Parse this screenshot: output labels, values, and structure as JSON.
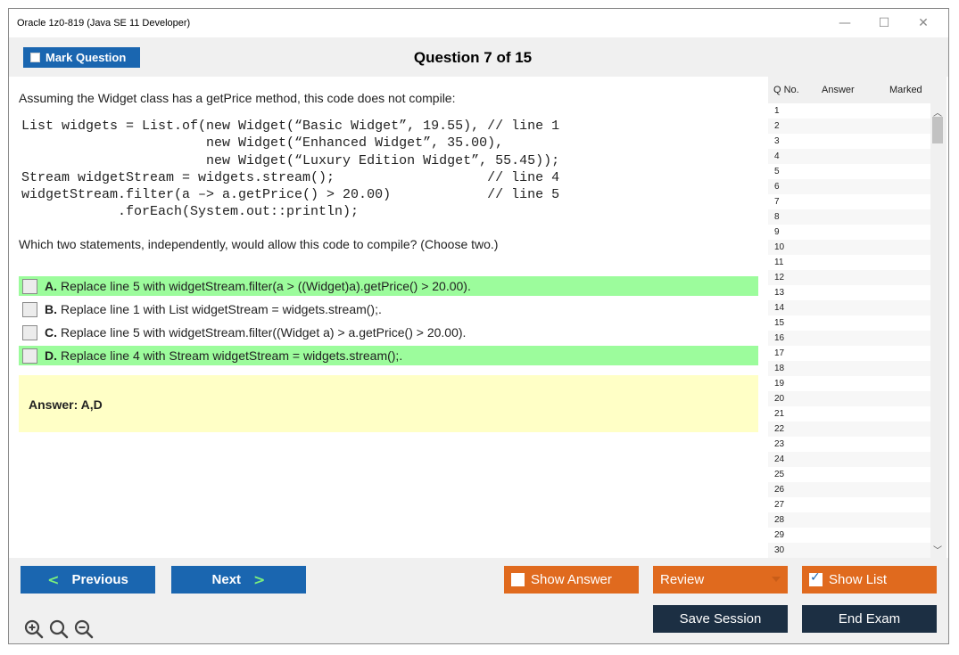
{
  "window": {
    "title": "Oracle 1z0-819 (Java SE 11 Developer)",
    "controls": {
      "minimize": "—",
      "maximize": "☐",
      "close": "✕"
    }
  },
  "header": {
    "mark_question_label": "Mark Question",
    "question_title": "Question 7 of 15"
  },
  "question": {
    "prompt": "Assuming the Widget class has a getPrice method, this code does not compile:",
    "code_lines": [
      "List widgets = List.of(new Widget(“Basic Widget”, 19.55), // line 1",
      "                       new Widget(“Enhanced Widget”, 35.00),",
      "                       new Widget(“Luxury Edition Widget”, 55.45));",
      "Stream widgetStream = widgets.stream();                   // line 4",
      "widgetStream.filter(a –> a.getPrice() > 20.00)            // line 5",
      "            .forEach(System.out::println);"
    ],
    "instruction": "Which two statements, independently, would allow this code to compile? (Choose two.)",
    "options": [
      {
        "letter": "A.",
        "text": "Replace line 5 with widgetStream.filter(a > ((Widget)a).getPrice() > 20.00).",
        "highlighted": true
      },
      {
        "letter": "B.",
        "text": "Replace line 1 with List widgetStream = widgets.stream();.",
        "highlighted": false
      },
      {
        "letter": "C.",
        "text": "Replace line 5 with widgetStream.filter((Widget a) > a.getPrice() > 20.00).",
        "highlighted": false
      },
      {
        "letter": "D.",
        "text": "Replace line 4 with Stream widgetStream = widgets.stream();.",
        "highlighted": true
      }
    ],
    "answer_text": "Answer: A,D"
  },
  "question_list": {
    "headers": {
      "qno": "Q No.",
      "answer": "Answer",
      "marked": "Marked"
    },
    "rows": [
      "1",
      "2",
      "3",
      "4",
      "5",
      "6",
      "7",
      "8",
      "9",
      "10",
      "11",
      "12",
      "13",
      "14",
      "15",
      "16",
      "17",
      "18",
      "19",
      "20",
      "21",
      "22",
      "23",
      "24",
      "25",
      "26",
      "27",
      "28",
      "29",
      "30"
    ]
  },
  "footer": {
    "previous_label": "Previous",
    "next_label": "Next",
    "show_answer_label": "Show Answer",
    "review_label": "Review",
    "show_list_label": "Show List",
    "save_session_label": "Save Session",
    "end_exam_label": "End Exam"
  },
  "colors": {
    "primary_blue": "#1a66b0",
    "orange": "#e06a1e",
    "dark_navy": "#1c2f43",
    "correct_highlight": "#9cfc9c",
    "answer_background": "#ffffc6"
  },
  "icons": {
    "zoom_in": "zoom-in-icon",
    "zoom_reset": "zoom-reset-icon",
    "zoom_out": "zoom-out-icon"
  }
}
